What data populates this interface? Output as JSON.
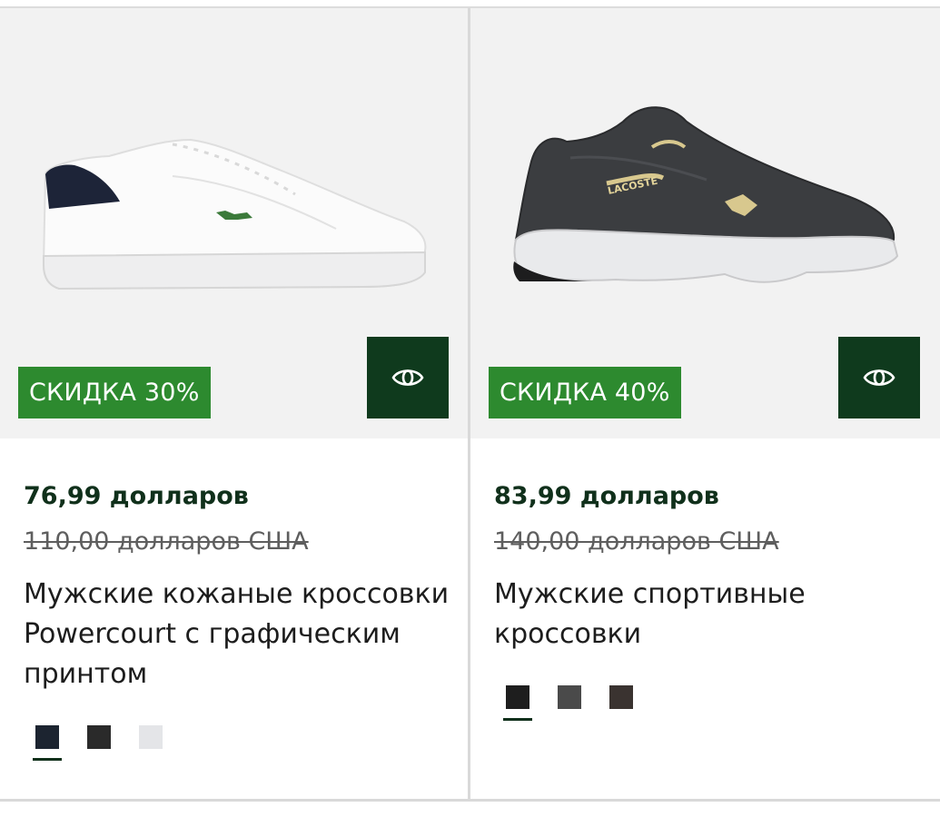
{
  "products": [
    {
      "discount": "СКИДКА 30%",
      "price": "76,99 долларов",
      "old_price": "110,00 долларов США",
      "name": "Мужские кожаные кроссовки Powercourt с графическим принтом",
      "swatch_colors": [
        "#1c2430",
        "#2a2a2a",
        "#e4e5e8"
      ],
      "selected_swatch": 0,
      "image": "white-leather-sneaker"
    },
    {
      "discount": "СКИДКА 40%",
      "price": "83,99 долларов",
      "old_price": "140,00 долларов США",
      "name": "Мужские спортивные кроссовки",
      "swatch_colors": [
        "#1e1e1e",
        "#4a4a4a",
        "#3a3330"
      ],
      "selected_swatch": 0,
      "image": "dark-grey-sport-sneaker",
      "logo_text": "LACOSTE"
    }
  ],
  "colors": {
    "discount_badge": "#2d8a2f",
    "quickview_button": "#0f3a1d",
    "price": "#10301b"
  },
  "icons": {
    "quickview": "eye-icon"
  }
}
